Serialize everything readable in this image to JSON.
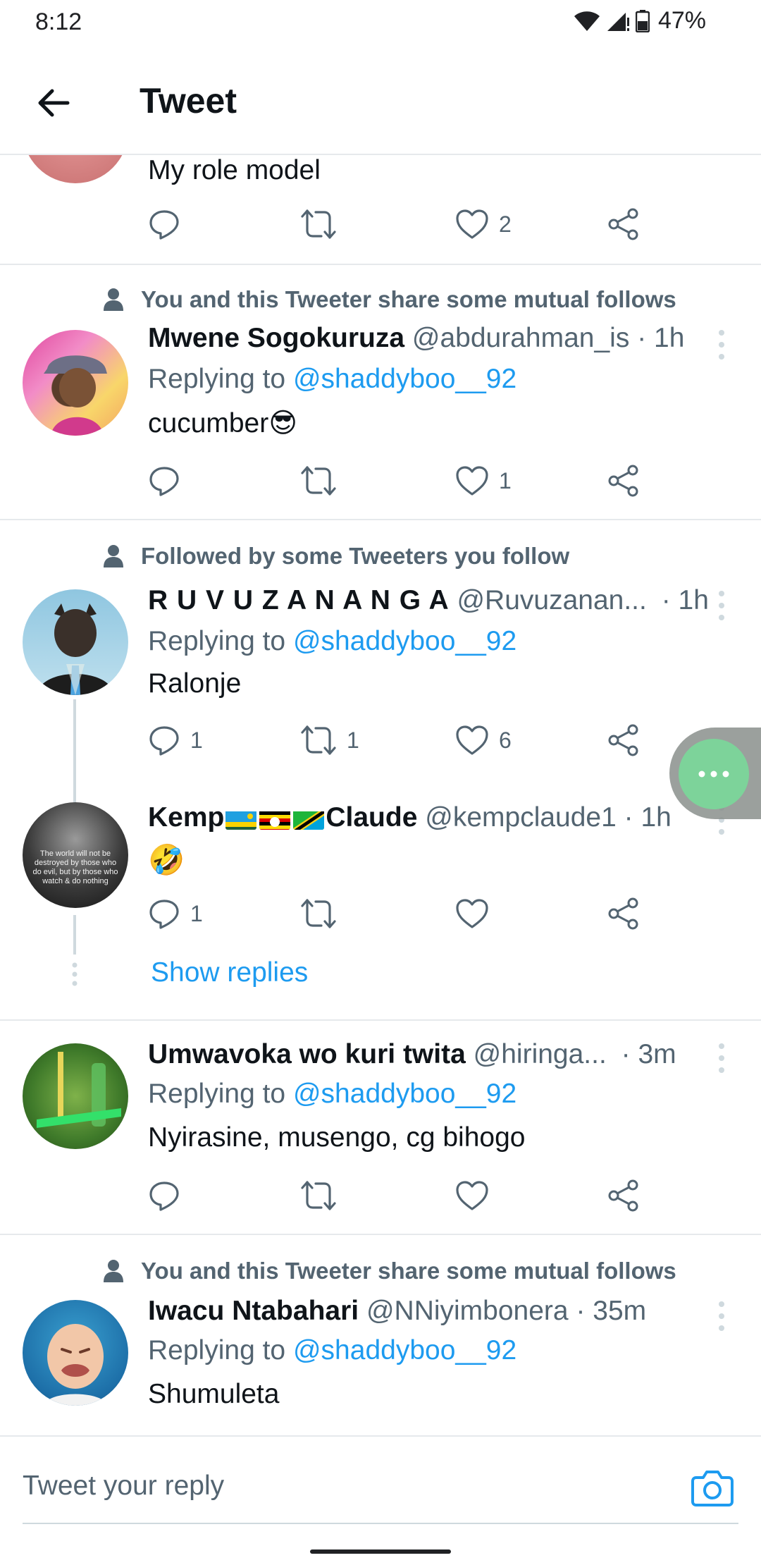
{
  "status_bar": {
    "time": "8:12",
    "battery": "47%"
  },
  "header": {
    "title": "Tweet"
  },
  "top_partial": {
    "text": "My role model",
    "actions": {
      "reply": "",
      "retweet": "",
      "like": "2"
    }
  },
  "replies": [
    {
      "context": "You and this Tweeter share some mutual follows",
      "name": "Mwene Sogokuruza",
      "handle": "@abdurahman_is",
      "time": "· 1h",
      "replying_prefix": "Replying to",
      "replying_handle": "@shaddyboo__92",
      "text": "cucumber😎",
      "actions": {
        "reply": "",
        "retweet": "",
        "like": "1"
      }
    },
    {
      "context": "Followed by some Tweeters you follow",
      "name": "R U V U Z A N A N G A",
      "handle": "@Ruvuzanan...",
      "time": "· 1h",
      "replying_prefix": "Replying to",
      "replying_handle": "@shaddyboo__92",
      "text": "Ralonje",
      "actions": {
        "reply": "1",
        "retweet": "1",
        "like": "6"
      }
    },
    {
      "name_part1": "Kemp",
      "name_part2": "Claude",
      "handle": "@kempclaude1",
      "time": "· 1h",
      "text": "🤣",
      "avatar_text": "The world will not be destroyed by those who do evil, but by those who watch & do nothing",
      "actions": {
        "reply": "1",
        "retweet": "",
        "like": ""
      },
      "show_replies": "Show replies"
    },
    {
      "name": "Umwavoka wo kuri twita",
      "handle": "@hiringa...",
      "time": "· 3m",
      "replying_prefix": "Replying to",
      "replying_handle": "@shaddyboo__92",
      "text": "Nyirasine, musengo, cg bihogo",
      "actions": {
        "reply": "",
        "retweet": "",
        "like": ""
      }
    },
    {
      "context": "You and this Tweeter share some mutual follows",
      "name": "Iwacu Ntabahari",
      "handle": "@NNiyimbonera",
      "time": "· 35m",
      "replying_prefix": "Replying to",
      "replying_handle": "@shaddyboo__92",
      "text": "Shumuleta"
    }
  ],
  "composer": {
    "placeholder": "Tweet your reply"
  },
  "colors": {
    "accent": "#1d9bf0",
    "secondary_text": "#536471",
    "divider": "#e6e9ec",
    "fab": "#7dd39a"
  },
  "icons": [
    "back-arrow-icon",
    "reply-icon",
    "retweet-icon",
    "like-icon",
    "share-icon",
    "person-icon",
    "more-icon",
    "camera-icon"
  ]
}
